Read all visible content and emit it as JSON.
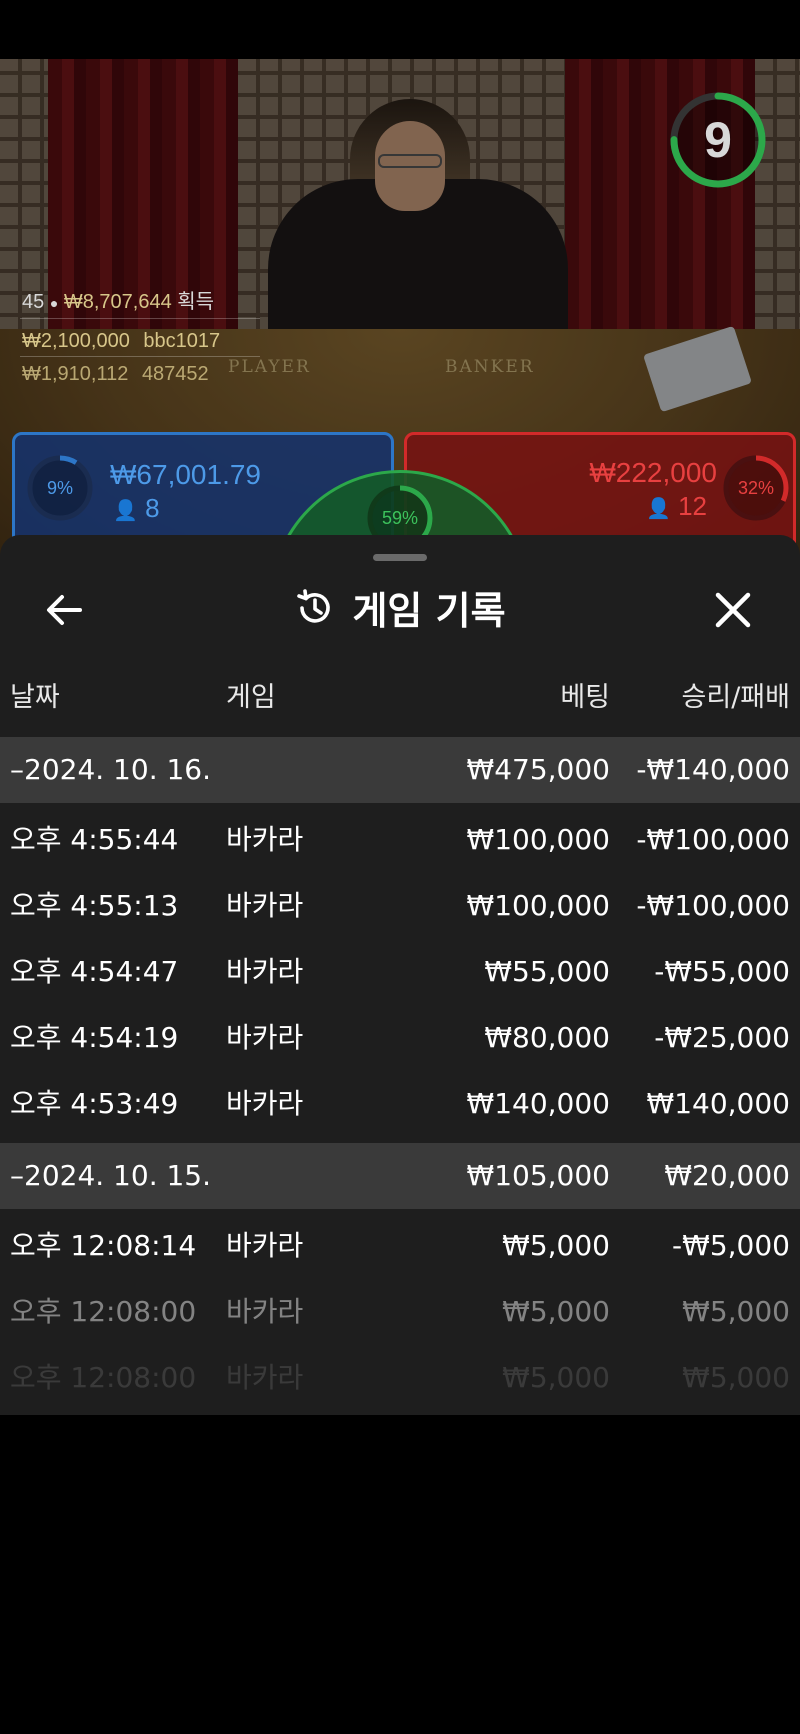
{
  "video": {
    "table_labels": {
      "player": "PLAYER",
      "banker": "BANKER"
    },
    "timer": {
      "value": "9",
      "progress": 0.75,
      "color": "#2ca84a"
    },
    "winners": [
      {
        "rank": "45",
        "icon": "person-icon",
        "amount": "₩8,707,644",
        "suffix": "획득"
      },
      {
        "amount": "₩2,100,000",
        "user": "bbc1017"
      },
      {
        "amount": "₩1,910,112",
        "user": "487452"
      }
    ],
    "bets": {
      "player": {
        "percent": "9%",
        "percent_value": 0.09,
        "amount": "₩67,001.79",
        "count": "8",
        "color": "#2d76c7"
      },
      "banker": {
        "percent": "32%",
        "percent_value": 0.32,
        "amount": "₩222,000",
        "count": "12",
        "color": "#d22a2a"
      },
      "tie": {
        "percent": "59%",
        "percent_value": 0.59,
        "color": "#2ca84a"
      }
    }
  },
  "sheet": {
    "title": "게임 기록",
    "icons": {
      "back": "arrow-left-icon",
      "history": "history-icon",
      "close": "close-icon"
    },
    "columns": {
      "date": "날짜",
      "game": "게임",
      "bet": "베팅",
      "winloss": "승리/패배"
    },
    "groups": [
      {
        "date": "–2024. 10. 16.",
        "bet_total": "₩475,000",
        "winloss_total": "-₩140,000",
        "rows": [
          {
            "time": "오후 4:55:44",
            "game": "바카라",
            "bet": "₩100,000",
            "winloss": "-₩100,000"
          },
          {
            "time": "오후 4:55:13",
            "game": "바카라",
            "bet": "₩100,000",
            "winloss": "-₩100,000"
          },
          {
            "time": "오후 4:54:47",
            "game": "바카라",
            "bet": "₩55,000",
            "winloss": "-₩55,000"
          },
          {
            "time": "오후 4:54:19",
            "game": "바카라",
            "bet": "₩80,000",
            "winloss": "-₩25,000"
          },
          {
            "time": "오후 4:53:49",
            "game": "바카라",
            "bet": "₩140,000",
            "winloss": "₩140,000"
          }
        ]
      },
      {
        "date": "–2024. 10. 15.",
        "bet_total": "₩105,000",
        "winloss_total": "₩20,000",
        "rows": [
          {
            "time": "오후 12:08:14",
            "game": "바카라",
            "bet": "₩5,000",
            "winloss": "-₩5,000"
          },
          {
            "time": "오후 12:08:00",
            "game": "바카라",
            "bet": "₩5,000",
            "winloss": "₩5,000"
          },
          {
            "time": "오후 12:08:00",
            "game": "바카라",
            "bet": "₩5,000",
            "winloss": "₩5,000"
          }
        ]
      }
    ]
  }
}
